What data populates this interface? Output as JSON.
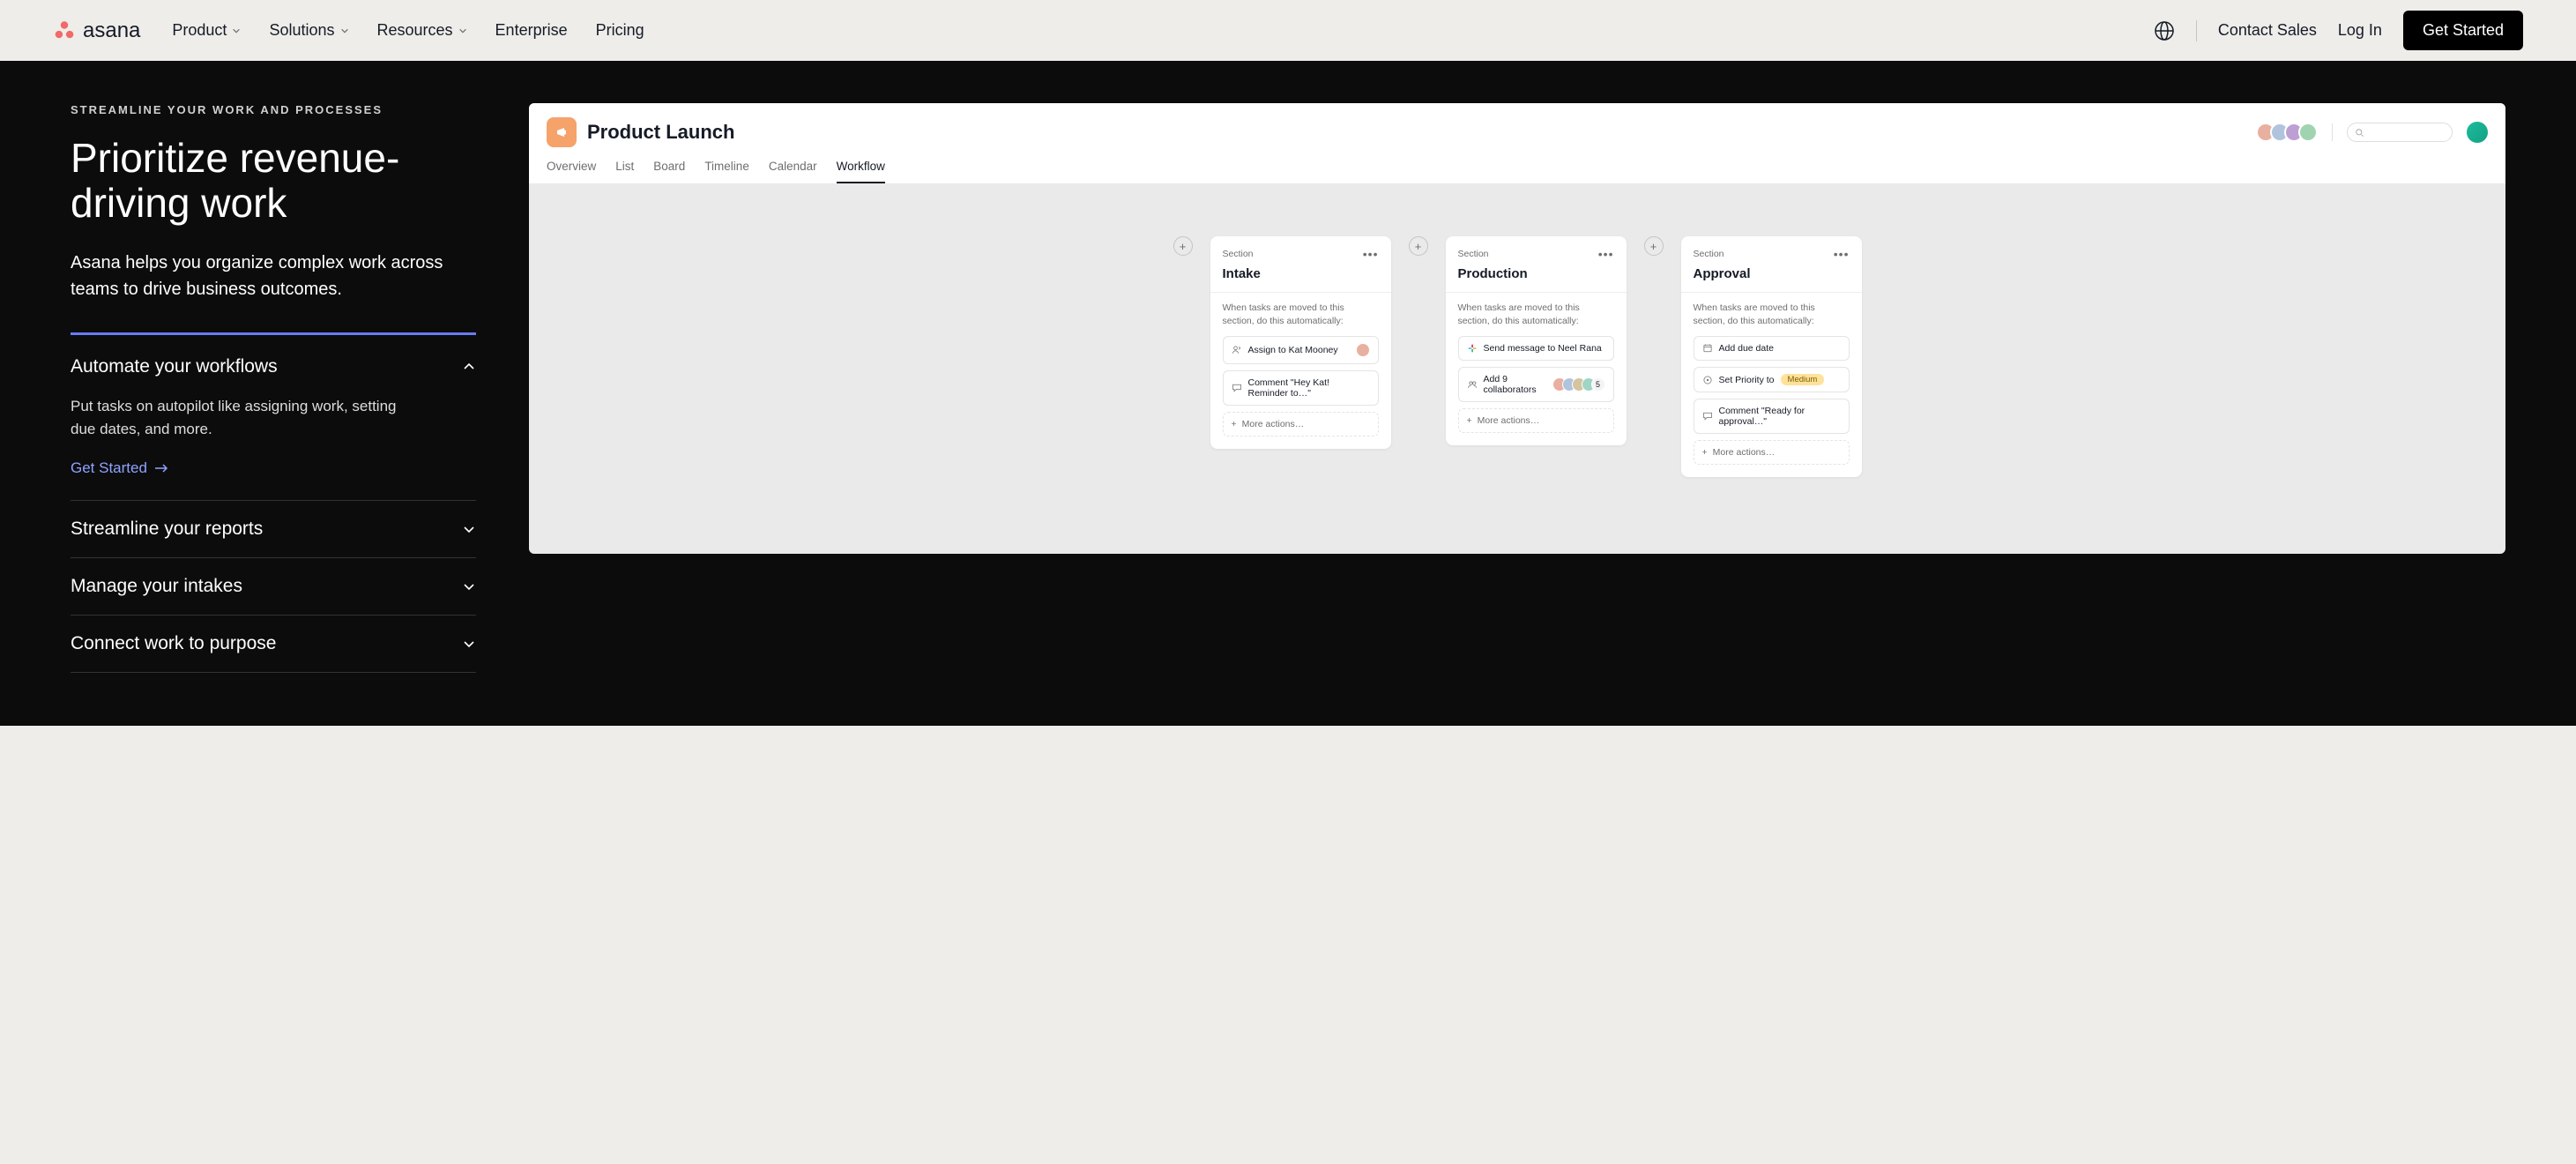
{
  "nav": {
    "brand": "asana",
    "links": {
      "product": "Product",
      "solutions": "Solutions",
      "resources": "Resources",
      "enterprise": "Enterprise",
      "pricing": "Pricing"
    },
    "contact": "Contact Sales",
    "login": "Log In",
    "cta": "Get Started"
  },
  "hero": {
    "eyebrow": "STREAMLINE YOUR WORK AND PROCESSES",
    "title": "Prioritize revenue-driving work",
    "sub": "Asana helps you organize complex work across teams to drive business outcomes."
  },
  "accordion": {
    "item1": {
      "title": "Automate your workflows",
      "body": "Put tasks on autopilot like assigning work, setting due dates, and more.",
      "link": "Get Started"
    },
    "item2": {
      "title": "Streamline your reports"
    },
    "item3": {
      "title": "Manage your intakes"
    },
    "item4": {
      "title": "Connect work to purpose"
    }
  },
  "app": {
    "title": "Product Launch",
    "tabs": {
      "overview": "Overview",
      "list": "List",
      "board": "Board",
      "timeline": "Timeline",
      "calendar": "Calendar",
      "workflow": "Workflow"
    },
    "section_label": "Section",
    "trigger_text": "When tasks are moved to this section, do this automatically:",
    "more_actions": "More actions…",
    "cards": {
      "intake": {
        "name": "Intake",
        "a1": "Assign to Kat Mooney",
        "a2": "Comment \"Hey Kat! Reminder to…\""
      },
      "production": {
        "name": "Production",
        "a1": "Send message to Neel Rana",
        "a2": "Add 9 collaborators",
        "count": "5"
      },
      "approval": {
        "name": "Approval",
        "a1": "Add due date",
        "a2_pre": "Set Priority to",
        "a2_badge": "Medium",
        "a3": "Comment \"Ready for approval…\""
      }
    }
  }
}
